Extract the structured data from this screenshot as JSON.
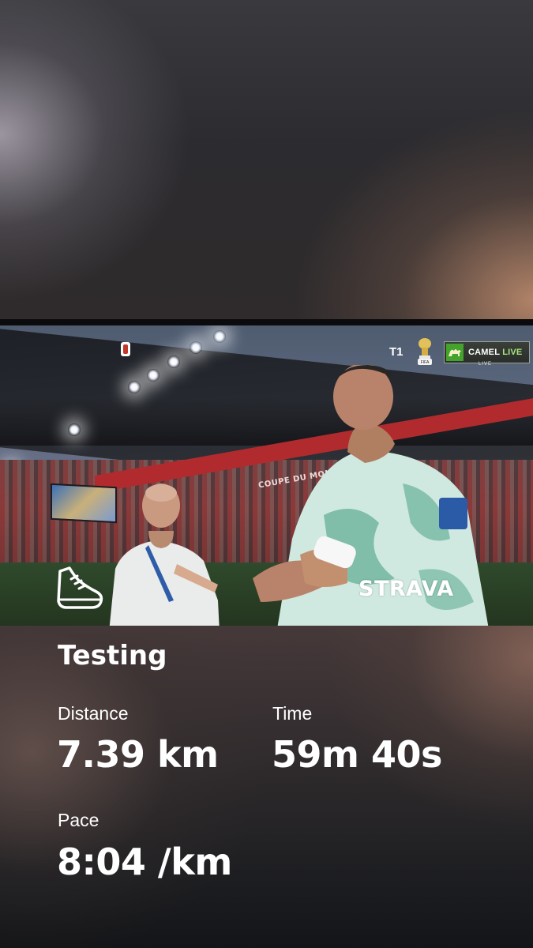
{
  "activity": {
    "title": "Testing"
  },
  "stats": {
    "distance_label": "Distance",
    "distance_value": "7.39 km",
    "time_label": "Time",
    "time_value": "59m 40s",
    "pace_label": "Pace",
    "pace_value": "8:04 /km"
  },
  "overlay": {
    "brand": "STRAVA",
    "activity_icon": "running-shoe-icon",
    "broadcast_channel": "T1",
    "broadcast_trophy_icon": "fifa-trophy-icon",
    "broadcaster_name": "CAMEL",
    "broadcaster_live": "LIVE",
    "broadcaster_sub": "LIVE",
    "stadium_banner": "COUPE DU MONDE DE LA FIFA"
  },
  "colors": {
    "text": "#ffffff",
    "camel_green": "#43a32c",
    "live_green": "#a6e57c",
    "banner_red": "#b12b2e"
  }
}
